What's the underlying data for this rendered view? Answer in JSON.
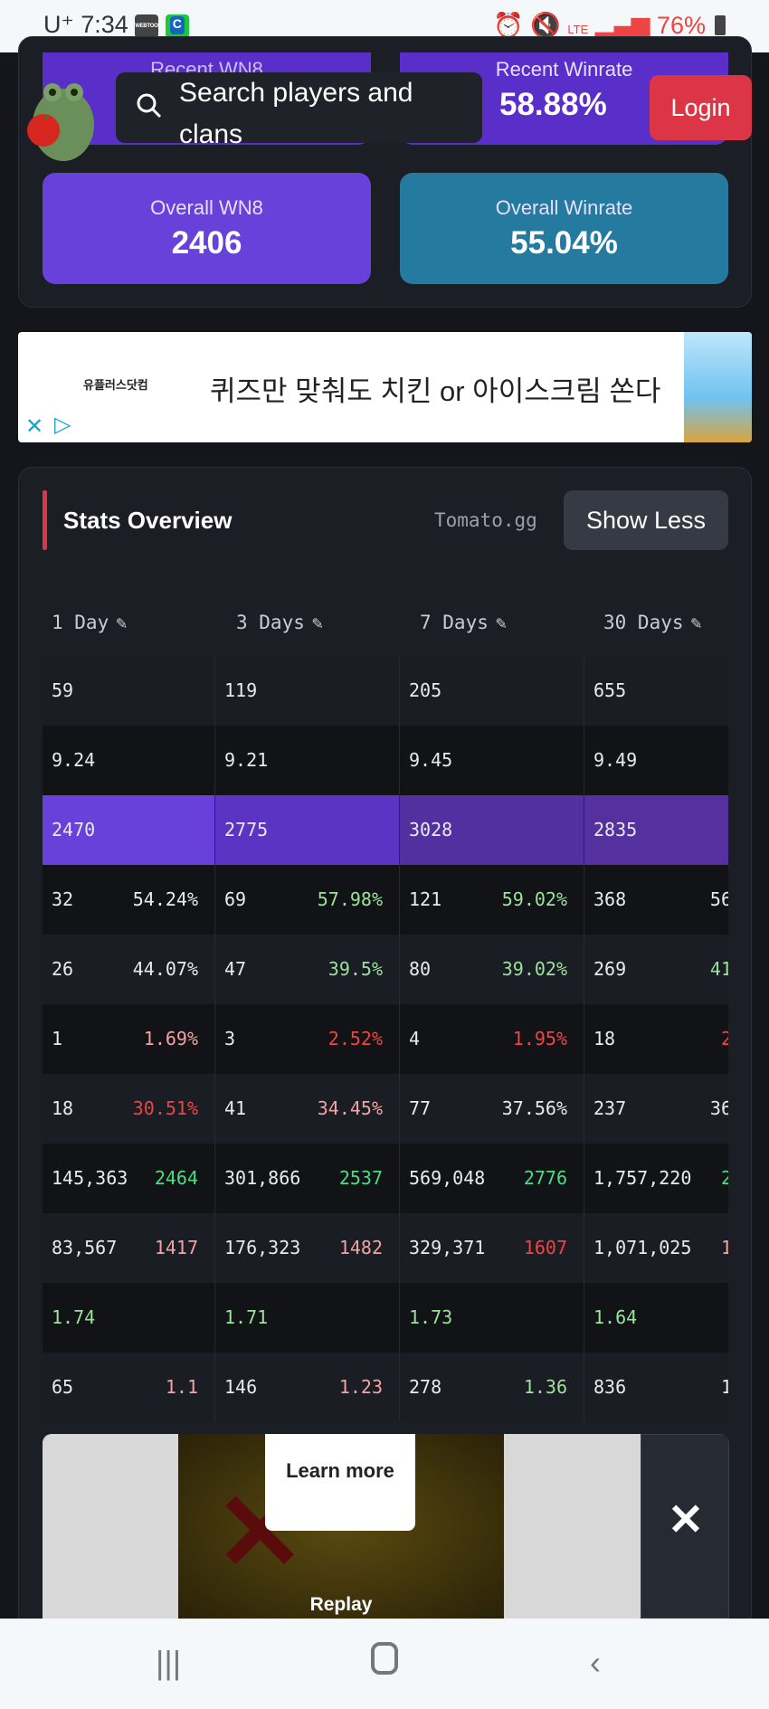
{
  "status_bar": {
    "carrier": "U⁺",
    "time": "7:34",
    "app1": "WEBTOON",
    "network": "LTE",
    "battery": "76%"
  },
  "header": {
    "search_placeholder": "Search players and clans",
    "login": "Login"
  },
  "summary": {
    "recent_wn8": {
      "label": "Recent WN8"
    },
    "recent_winrate": {
      "label": "Recent Winrate",
      "value": "58.88%"
    },
    "overall_wn8": {
      "label": "Overall WN8",
      "value": "2406"
    },
    "overall_winrate": {
      "label": "Overall Winrate",
      "value": "55.04%"
    }
  },
  "ad_banner": {
    "brand": "유플러스닷컴",
    "headline": "퀴즈만 맞춰도 치킨 or 아이스크림 쏜다"
  },
  "stats": {
    "title": "Stats Overview",
    "watermark": "Tomato.gg",
    "toggle": "Show Less",
    "columns": [
      "1 Day",
      "3 Days",
      "7 Days",
      "30 Days"
    ],
    "wn8_colors": [
      "#6741d9",
      "#5b34c4",
      "#52309f",
      "#55309f"
    ],
    "rows": [
      [
        [
          "59"
        ],
        [
          "119"
        ],
        [
          "205"
        ],
        [
          "655"
        ]
      ],
      [
        [
          "9.24"
        ],
        [
          "9.21"
        ],
        [
          "9.45"
        ],
        [
          "9.49"
        ]
      ],
      [
        [
          "2470"
        ],
        [
          "2775"
        ],
        [
          "3028"
        ],
        [
          "2835"
        ]
      ],
      [
        [
          "32",
          "54.24%",
          "w"
        ],
        [
          "69",
          "57.98%",
          "lg"
        ],
        [
          "121",
          "59.02%",
          "lg"
        ],
        [
          "368",
          "56",
          "w"
        ]
      ],
      [
        [
          "26",
          "44.07%",
          "w"
        ],
        [
          "47",
          "39.5%",
          "lg"
        ],
        [
          "80",
          "39.02%",
          "lg"
        ],
        [
          "269",
          "41",
          "lg"
        ]
      ],
      [
        [
          "1",
          "1.69%",
          "p"
        ],
        [
          "3",
          "2.52%",
          "r"
        ],
        [
          "4",
          "1.95%",
          "r"
        ],
        [
          "18",
          "2",
          "r"
        ]
      ],
      [
        [
          "18",
          "30.51%",
          "r"
        ],
        [
          "41",
          "34.45%",
          "p"
        ],
        [
          "77",
          "37.56%",
          "w"
        ],
        [
          "237",
          "36",
          "w"
        ]
      ],
      [
        [
          "145,363",
          "2464",
          "g"
        ],
        [
          "301,866",
          "2537",
          "g"
        ],
        [
          "569,048",
          "2776",
          "g"
        ],
        [
          "1,757,220",
          "2",
          "g"
        ]
      ],
      [
        [
          "83,567",
          "1417",
          "p"
        ],
        [
          "176,323",
          "1482",
          "p"
        ],
        [
          "329,371",
          "1607",
          "r"
        ],
        [
          "1,071,025",
          "1",
          "p"
        ]
      ],
      [
        [
          "1.74",
          "",
          "",
          "lg"
        ],
        [
          "1.71",
          "",
          "",
          "lg"
        ],
        [
          "1.73",
          "",
          "",
          "lg"
        ],
        [
          "1.64",
          "",
          "",
          "lg"
        ]
      ],
      [
        [
          "65",
          "1.1",
          "p"
        ],
        [
          "146",
          "1.23",
          "p"
        ],
        [
          "278",
          "1.36",
          "lg"
        ],
        [
          "836",
          "1",
          "w"
        ]
      ],
      [
        [
          ""
        ],
        [
          ""
        ],
        [
          ""
        ],
        [
          ""
        ]
      ]
    ]
  },
  "video_ad": {
    "learn_more": "Learn more",
    "replay": "Replay",
    "close": "✕"
  }
}
